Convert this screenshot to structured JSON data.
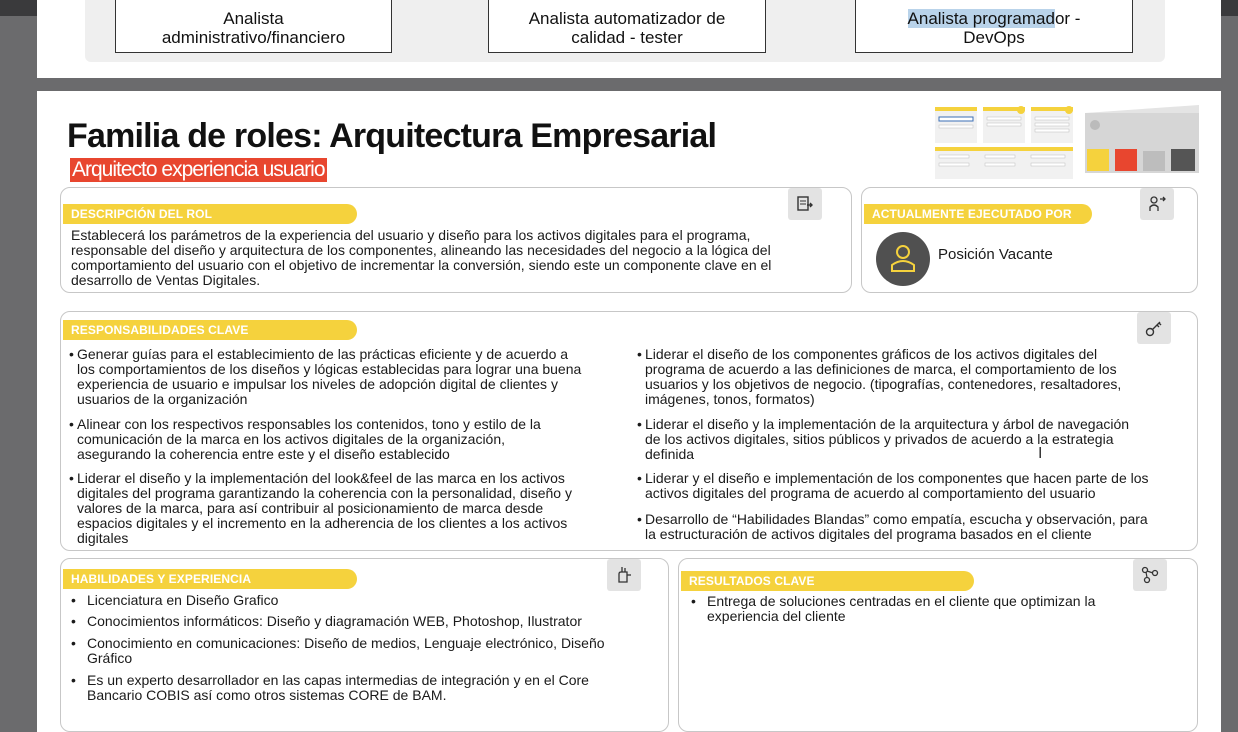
{
  "prev_page": {
    "roles": [
      {
        "line1": "Analista",
        "line2": "administrativo/financiero"
      },
      {
        "line1": "Analista automatizador de",
        "line2": "calidad - tester"
      },
      {
        "line1_highlight": "Analista programad",
        "line1_rest": "or -",
        "line2": "DevOps"
      }
    ]
  },
  "page": {
    "title": "Familia de roles: Arquitectura Empresarial",
    "subtitle": "Arquitecto experiencia usuario"
  },
  "descripcion": {
    "header": "DESCRIPCIÓN DEL ROL",
    "lines": [
      "Establecerá los parámetros de la experiencia del usuario y diseño para los activos digitales para el programa,",
      "responsable del diseño y arquitectura de los componentes, alineando las necesidades del negocio a la lógica del",
      "comportamiento del usuario con el objetivo de incrementar la conversión, siendo este un componente clave en el",
      "desarrollo de Ventas Digitales."
    ]
  },
  "ejecutado": {
    "header": "ACTUALMENTE EJECUTADO POR",
    "value": "Posición Vacante"
  },
  "responsabilidades": {
    "header": "RESPONSABILIDADES CLAVE",
    "left": [
      [
        "Generar guías para el establecimiento de las prácticas eficiente y de acuerdo a",
        "los comportamientos de los diseños y lógicas establecidas para lograr una buena",
        "experiencia de usuario e impulsar los niveles de adopción digital de clientes y",
        "usuarios de la organización"
      ],
      [
        "Alinear con los respectivos responsables los contenidos, tono y estilo de la",
        "comunicación de la marca en los activos digitales de la organización,",
        "asegurando la coherencia entre este y el diseño establecido"
      ],
      [
        "Liderar el diseño y la implementación del look&feel de las marca en los activos",
        "digitales del programa garantizando la coherencia con la personalidad, diseño y",
        "valores de la marca, para así contribuir al posicionamiento de marca desde",
        "espacios digitales y el incremento en la adherencia de los clientes a los activos",
        "digitales"
      ]
    ],
    "right": [
      [
        "Liderar el diseño de los componentes gráficos de los activos digitales del",
        "programa de acuerdo a las definiciones de marca, el comportamiento de los",
        "usuarios y los objetivos de negocio. (tipografías, contenedores, resaltadores,",
        "imágenes, tonos, formatos)"
      ],
      [
        "Liderar el diseño y la implementación de la arquitectura y árbol de navegación",
        "de los activos digitales, sitios públicos y privados de acuerdo a la estrategia",
        "definida"
      ],
      [
        "Liderar y el diseño e implementación de los componentes que hacen parte de los",
        "activos digitales del programa de acuerdo al comportamiento del usuario"
      ],
      [
        "Desarrollo de “Habilidades Blandas” como empatía, escucha y observación, para",
        "la estructuración de activos digitales del programa basados en el cliente"
      ]
    ]
  },
  "habilidades": {
    "header": "HABILIDADES Y EXPERIENCIA",
    "items": [
      [
        "Licenciatura en Diseño Grafico"
      ],
      [
        "Conocimientos informáticos: Diseño y diagramación WEB, Photoshop, Ilustrator"
      ],
      [
        "Conocimiento en comunicaciones: Diseño de medios, Lenguaje electrónico, Diseño",
        "Gráfico"
      ],
      [
        "Es un experto desarrollador en las capas intermedias de integración y en el Core",
        "Bancario COBIS así como otros sistemas CORE de BAM."
      ]
    ]
  },
  "resultados": {
    "header": "RESULTADOS CLAVE",
    "items": [
      [
        "Entrega de soluciones centradas en el cliente que optimizan la",
        "experiencia del cliente"
      ]
    ]
  },
  "icons": {
    "descripcion": "document-arrow-icon",
    "ejecutado": "people-arrows-icon",
    "responsabilidades": "key-icon",
    "habilidades": "hand-pen-icon",
    "resultados": "network-nodes-icon",
    "avatar": "person-outline-icon"
  },
  "colors": {
    "accent_yellow": "#f5d23d",
    "subtitle_red": "#e8462f",
    "highlight_blue": "#b9d3ea",
    "avatar_grey": "#505050"
  }
}
